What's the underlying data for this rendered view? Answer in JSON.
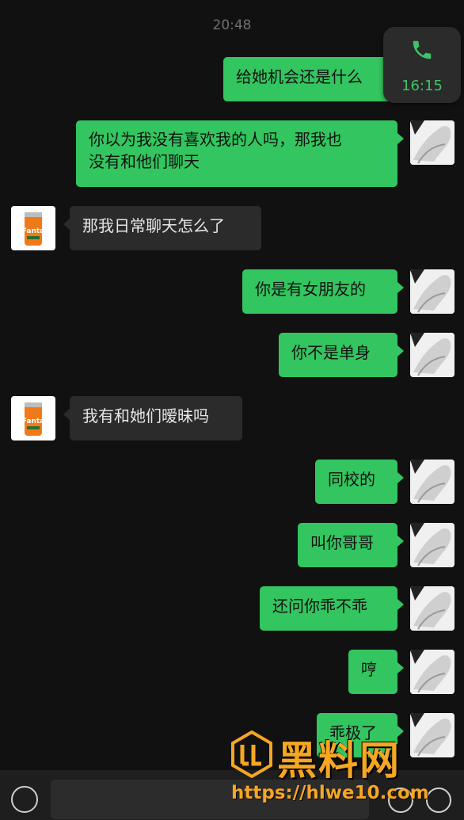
{
  "header": {
    "timestamp": "20:48"
  },
  "call_widget": {
    "duration": "16:15",
    "icon": "phone-icon",
    "color": "#3ec26a"
  },
  "colors": {
    "outgoing_bubble": "#33c55f",
    "incoming_bubble": "#2b2b2b",
    "background": "#111111"
  },
  "messages": [
    {
      "side": "out",
      "lines": [
        "给她机会还是什么"
      ]
    },
    {
      "side": "out",
      "lines": [
        "你以为我没有喜欢我的人吗，那我也",
        "没有和他们聊天"
      ]
    },
    {
      "side": "in",
      "lines": [
        "那我日常聊天怎么了"
      ]
    },
    {
      "side": "out",
      "lines": [
        "你是有女朋友的"
      ]
    },
    {
      "side": "out",
      "lines": [
        "你不是单身"
      ]
    },
    {
      "side": "in",
      "lines": [
        "我有和她们暧昧吗"
      ]
    },
    {
      "side": "out",
      "lines": [
        "同校的"
      ]
    },
    {
      "side": "out",
      "lines": [
        "叫你哥哥"
      ]
    },
    {
      "side": "out",
      "lines": [
        "还问你乖不乖"
      ]
    },
    {
      "side": "out",
      "lines": [
        "哼"
      ]
    },
    {
      "side": "out",
      "lines": [
        "乖极了"
      ]
    }
  ],
  "input_bar": {
    "voice_icon": "voice-icon",
    "emoji_icon": "emoji-icon",
    "plus_icon": "plus-icon"
  },
  "watermark": {
    "title": "黑料网",
    "url": "https://hlwe10.com"
  }
}
